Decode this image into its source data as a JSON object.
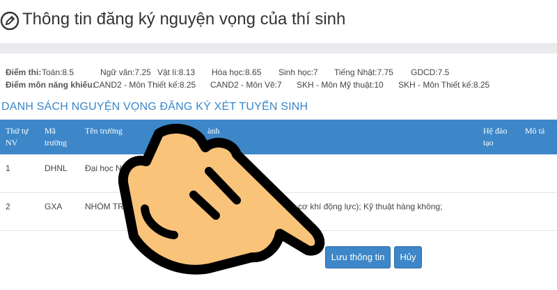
{
  "header": {
    "title": "Thông tin đăng ký nguyện vọng của thí sinh"
  },
  "scores": {
    "exam_label": "Điểm thi:",
    "exam": [
      "Toán:8.5",
      "Ngữ văn:7.25",
      "Vật lí:8.13",
      "Hóa học:8.65",
      "Sinh học:7",
      "Tiếng Nhật:7.75",
      "GDCD:7.5"
    ],
    "talent_label": "Điểm môn năng khiếu:",
    "talent": [
      "CAND2 - Môn Thiết kế:8.25",
      "CAND2 - Môn Vẽ:7",
      "SKH - Môn Mỹ thuật:10",
      "SKH - Môn Thiết kế:8.25"
    ]
  },
  "list_title": "DANH SÁCH NGUYỆN VỌNG ĐĂNG KÝ XÉT TUYỂN SINH",
  "table": {
    "headers": [
      "Thứ tự NV",
      "Mã trường",
      "Tên trường",
      "ành",
      "Hệ đào tạo",
      "Mô tả"
    ],
    "rows": [
      {
        "order": "1",
        "code": "DHNL",
        "school": "Đại học Nông Lâm",
        "major": "hóa học",
        "system": "",
        "desc": ""
      },
      {
        "order": "2",
        "code": "GXA",
        "school": "NHÓM TRƯ GX",
        "major": "khí chế tạo và cơ khí động lực); Kỹ thuật hàng không;",
        "system": "",
        "desc": ""
      }
    ]
  },
  "buttons": {
    "save": "Lưu thông tin",
    "cancel": "Hủy"
  },
  "colors": {
    "accent": "#3d87c9",
    "hand_fill": "#f9c37a",
    "hand_outline": "#000000"
  }
}
